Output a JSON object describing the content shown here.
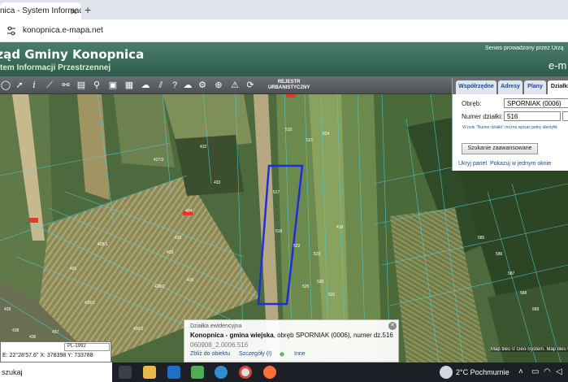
{
  "browser": {
    "tab_title": "nica - System Informacji P",
    "close": "✕",
    "new_tab": "+",
    "url": "konopnica.e-mapa.net"
  },
  "header": {
    "title": "rząd Gminy Konopnica",
    "subtitle": "tem Informacji Przestrzennej",
    "serwis": "Serwis prowadzony przez Urzą",
    "brand": "e-m"
  },
  "toolbar": {
    "rejestr_line1": "REJESTR",
    "rejestr_line2": "URBANISTYCZNY"
  },
  "panel": {
    "tabs": [
      "Współrzędne",
      "Adresy",
      "Plany",
      "Działki"
    ],
    "obreb_label": "Obręb:",
    "obreb_value": "SPORNIAK (0006)",
    "numer_label": "Numer działki:",
    "numer_value": "516",
    "hint": "W pole \"Numer działki\" można wpisać pełny identyfik",
    "advanced_button": "Szukanie zaawansowane",
    "hide_link": "Ukryj panel",
    "window_link": "Pokazuj w jednym oknie"
  },
  "popup": {
    "heading": "Działka ewidencyjna",
    "line_bold": "Konopnica - gmina wiejska",
    "line_rest": ", obręb SPORNIAK (0006), numer dz.516",
    "identifier": "060908_2.0006.516",
    "link_zoom": "Zbliż do obiektu",
    "link_details": "Szczegóły (I)",
    "link_more": "Inne"
  },
  "coords": {
    "system": "PL-1992",
    "row": "E: 22°28'57.6\"  X: 378398   Y: 733788"
  },
  "attribution": "Map tiles © Geo-System. Map tiles © opens",
  "map_labels": [
    "516",
    "515",
    "517",
    "521",
    "524",
    "522",
    "523",
    "525",
    "526",
    "531",
    "432",
    "433",
    "425",
    "426",
    "427/2",
    "424",
    "428/1",
    "428/2",
    "439",
    "431",
    "430/1",
    "430/2",
    "429",
    "437",
    "436",
    "438",
    "418",
    "585",
    "586",
    "587",
    "588",
    "589"
  ],
  "taskbar": {
    "search": "szukaj",
    "weather": "2°C  Pochmurnie"
  },
  "colors": {
    "header": "#3d6e5c",
    "selection": "#1d2fd8",
    "parcel_line": "#4fd1e0"
  }
}
